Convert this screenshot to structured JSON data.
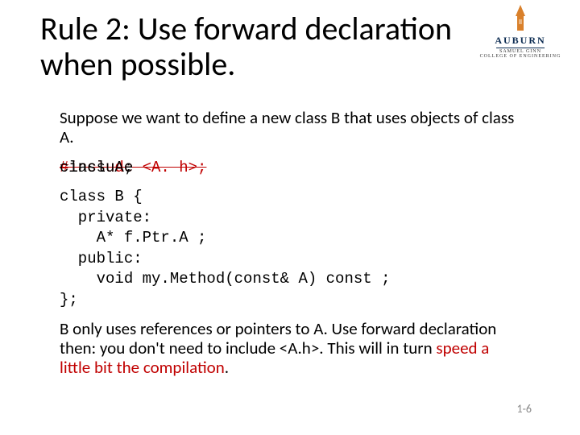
{
  "logo": {
    "wordmark": "AUBURN",
    "sub1": "SAMUEL GINN",
    "sub2": "COLLEGE OF ENGINEERING"
  },
  "title": "Rule 2: Use forward declaration when possible.",
  "intro": "Suppose we want to define a new class B that uses objects of class A.",
  "strike_line": {
    "layer_red_struck": "#include <A. h>;",
    "layer_black": " inclu e",
    "layer_black2": "class A;"
  },
  "code": "class B {\n  private:\n    A* f.Ptr.A ;\n  public:\n    void my.Method(const& A) const ;\n};",
  "outro": {
    "part1": "B only uses references or pointers to A. Use forward declaration then: you don't need to include <A.h>. This will in turn ",
    "highlight": "speed a little bit the compilation",
    "part2": "."
  },
  "pagenum": "1-6"
}
